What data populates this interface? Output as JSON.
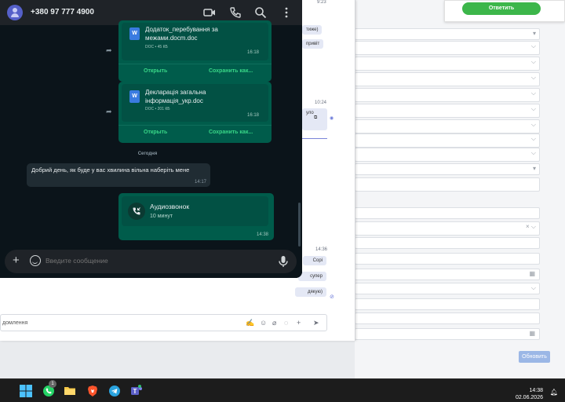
{
  "colors": {
    "wa_accent": "#38d687",
    "wa_outgoing": "#005c4b",
    "wa_incoming": "#202c33",
    "crm_answer": "#3cb64a",
    "crm_update": "#9bb7e6"
  },
  "crm": {
    "answer_label": "Ответить",
    "update_label": "Обновить"
  },
  "chatlog": {
    "times": [
      "9:23",
      "10:24",
      "14:36"
    ],
    "bubbles": [
      "тиже)",
      "привіт",
      "уло",
      "Сорі",
      "супер",
      "дякую)"
    ],
    "input_placeholder": "домлення"
  },
  "whatsapp": {
    "contact": "+380 97 777 4900",
    "docs": [
      {
        "name_line1": "Додаток_перебування за",
        "name_line2": "межами.docm.doc",
        "meta": "DOC • 45 КБ",
        "time": "16:18",
        "open": "Открыть",
        "save": "Сохранить как..."
      },
      {
        "name_line1": "Декларація загальна",
        "name_line2": "інформація_укр.doc",
        "meta": "DOC • 201 КБ",
        "time": "16:18",
        "open": "Открыть",
        "save": "Сохранить как..."
      }
    ],
    "day_separator": "Сегодня",
    "incoming": {
      "text": "Добрий день, як буде у вас хвилина вільна наберіть мене",
      "time": "14:17"
    },
    "call": {
      "title": "Аудиозвонок",
      "duration": "10 минут",
      "time": "14:38"
    },
    "compose_placeholder": "Введите сообщение"
  },
  "taskbar": {
    "time": "14:38",
    "date": "02.06.2026",
    "whatsapp_badge": "1",
    "icons": [
      "windows-icon",
      "whatsapp-icon",
      "file-explorer-icon",
      "brave-icon",
      "telegram-icon",
      "teams-icon"
    ]
  }
}
